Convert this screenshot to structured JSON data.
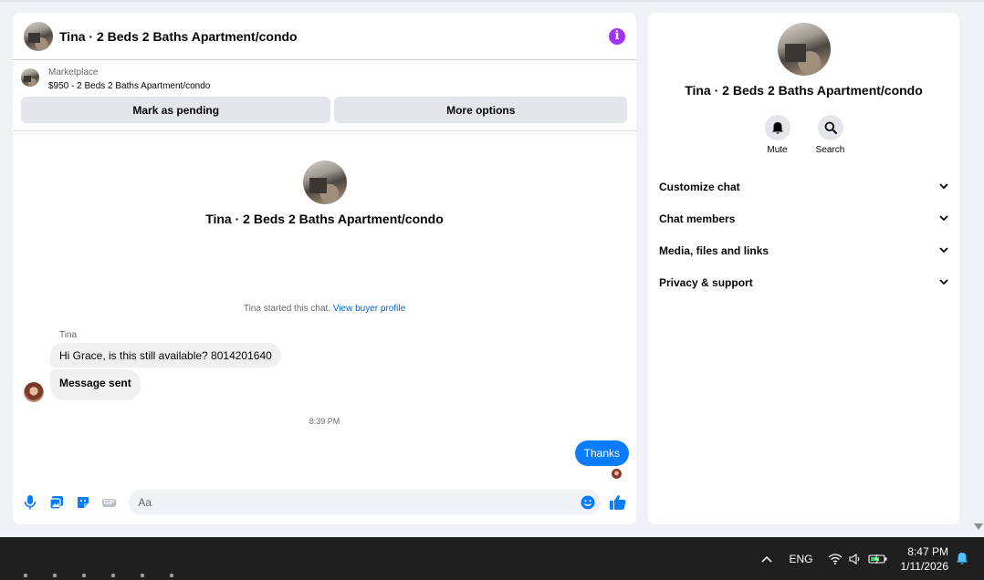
{
  "chat": {
    "title": "Tina · 2 Beds 2 Baths Apartment/condo",
    "info_icon_glyph": "i",
    "marketplace_label": "Marketplace",
    "marketplace_item": "$950 - 2 Beds 2 Baths Apartment/condo",
    "mark_pending_label": "Mark as pending",
    "more_options_label": "More options",
    "intro_title": "Tina · 2 Beds 2 Baths Apartment/condo",
    "started_text": "Tina started this chat. ",
    "view_profile_link": "View buyer profile",
    "sender_name": "Tina",
    "messages_in": [
      "Hi Grace, is this still available? 8014201640",
      "Message sent"
    ],
    "timestamp": "8:39 PM",
    "message_out": "Thanks",
    "gif_label": "GIF",
    "composer_placeholder": "Aa"
  },
  "side": {
    "title": "Tina · 2 Beds 2 Baths Apartment/condo",
    "actions": [
      {
        "label": "Mute",
        "icon": "bell-icon"
      },
      {
        "label": "Search",
        "icon": "search-icon"
      }
    ],
    "menu": [
      "Customize chat",
      "Chat members",
      "Media, files and links",
      "Privacy & support"
    ]
  },
  "taskbar": {
    "language": "ENG",
    "time": "8:47 PM",
    "date": "1/11/2026"
  },
  "colors": {
    "accent": "#0a7cff",
    "info": "#a033ff",
    "link": "#0064d1"
  }
}
